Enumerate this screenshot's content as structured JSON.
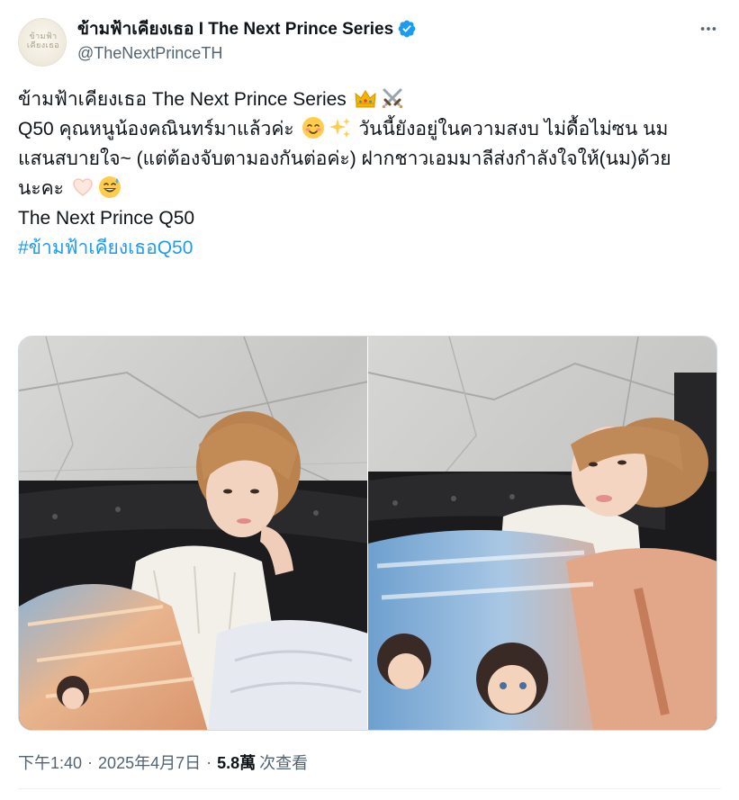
{
  "author": {
    "display_name": "ข้ามฟ้าเคียงเธอ I The Next Prince Series",
    "handle": "@TheNextPrinceTH",
    "avatar_text": "ข้ามฟ้า เคียงเธอ",
    "verified_color": "#1d9bf0"
  },
  "tweet": {
    "line1": "ข้ามฟ้าเคียงเธอ The Next Prince Series",
    "line1_emojis": [
      "crown-emoji",
      "crossed-swords-emoji"
    ],
    "line2_a": "Q50 คุณหนูน้องคณินทร์มาแล้วค่ะ",
    "line2_b": "วันนี้ยังอยู่ในความสงบ ไม่ดื้อไม่ซน นม",
    "line3": "แสนสบายใจ~ (แต่ต้องจับตามองกันต่อค่ะ) ฝากชาวเอมมาลีส่งกำลังใจให้(นม)ด้วย",
    "line4": "นะคะ",
    "line4_emojis": [
      "heart-hands-emoji",
      "grinning-sweat-emoji"
    ],
    "line5": "The Next Prince Q50",
    "hashtag": "#ข้ามฟ้าเคียงเธอQ50"
  },
  "media": [
    {
      "label": "photo-1"
    },
    {
      "label": "photo-2"
    }
  ],
  "meta": {
    "time": "下午1:40",
    "date": "2025年4月7日",
    "views_count": "5.8萬",
    "views_label": "次查看"
  },
  "colors": {
    "link": "#1d9bf0",
    "secondary_text": "#536471",
    "primary_text": "#0f1419"
  }
}
